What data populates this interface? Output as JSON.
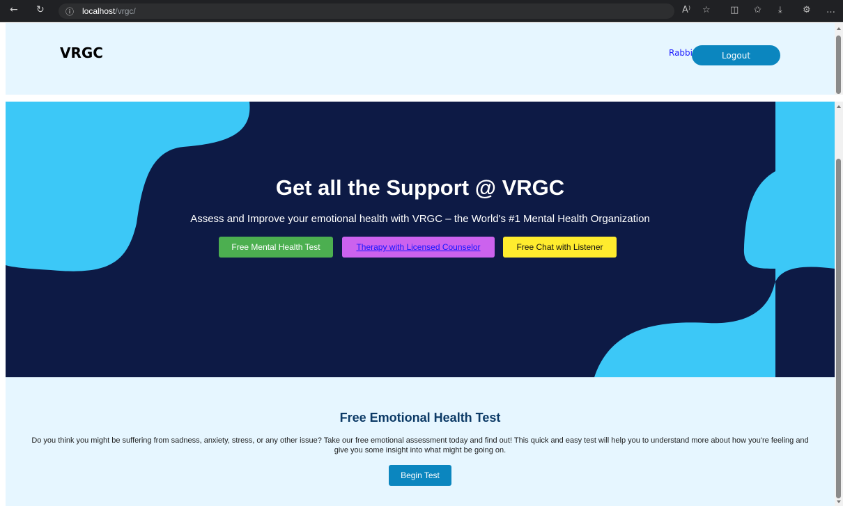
{
  "browser": {
    "back_icon": "back-arrow-icon",
    "reload_icon": "reload-icon",
    "info_icon": "info-icon",
    "url_host": "localhost",
    "url_path": "/vrgc/",
    "toolbar_icons": [
      "read-aloud-icon",
      "favorite-star-icon",
      "split-screen-icon",
      "favorites-icon",
      "download-icon",
      "extensions-icon",
      "more-icon"
    ]
  },
  "header": {
    "brand": "VRGC",
    "username": "Rabbi",
    "logout_label": "Logout"
  },
  "hero": {
    "title": "Get all the Support @ VRGC",
    "subtitle": "Assess and Improve your emotional health with VRGC – the World's #1 Mental Health Organization",
    "buttons": [
      {
        "label": "Free Mental Health Test",
        "color": "#4caf50"
      },
      {
        "label": "Therapy with Licensed Counselor",
        "color": "#cc62ee"
      },
      {
        "label": "Free Chat with Listener",
        "color": "#ffec2e"
      }
    ],
    "background_color": "#0d1a45",
    "blob_color": "#3cc8f7"
  },
  "test_section": {
    "title": "Free Emotional Health Test",
    "description": "Do you think you might be suffering from sadness, anxiety, stress, or any other issue? Take our free emotional assessment today and find out! This quick and easy test will help you to understand more about how you're feeling and give you some insight into what might be going on.",
    "button_label": "Begin Test"
  }
}
